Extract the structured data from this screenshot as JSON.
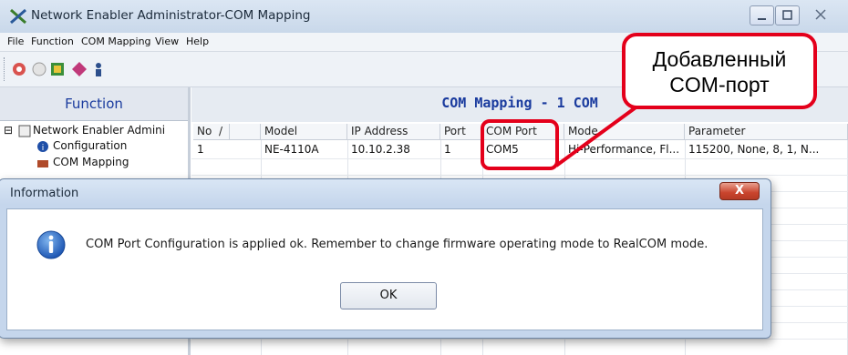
{
  "window": {
    "title": "Network Enabler Administrator-COM Mapping"
  },
  "menu": [
    "File",
    "Function",
    "COM Mapping",
    "View",
    "Help"
  ],
  "function_panel": {
    "header": "Function",
    "tree": [
      "Network Enabler Admini",
      "Configuration",
      "COM Mapping"
    ]
  },
  "grid": {
    "title": "COM Mapping - 1 COM",
    "columns": [
      "No",
      "/",
      "Model",
      "IP Address",
      "Port",
      "COM Port",
      "Mode",
      "Parameter"
    ],
    "row": {
      "no": "1",
      "model": "NE-4110A",
      "ip": "10.10.2.38",
      "port": "1",
      "com_port": "COM5",
      "mode": "Hi-Performance, Fl...",
      "parameter": "115200, None, 8, 1, N..."
    }
  },
  "callout": {
    "line1": "Добавленный",
    "line2": "COM-порт",
    "color": "#e4001b"
  },
  "dialog": {
    "title": "Information",
    "message": "COM Port Configuration is applied ok. Remember to change firmware operating mode to RealCOM mode.",
    "ok": "OK",
    "close_glyph": "X"
  },
  "icons": [
    "app-network-icon",
    "minimize-icon",
    "maximize-icon",
    "close-icon",
    "toolbar-icons",
    "info-icon"
  ]
}
